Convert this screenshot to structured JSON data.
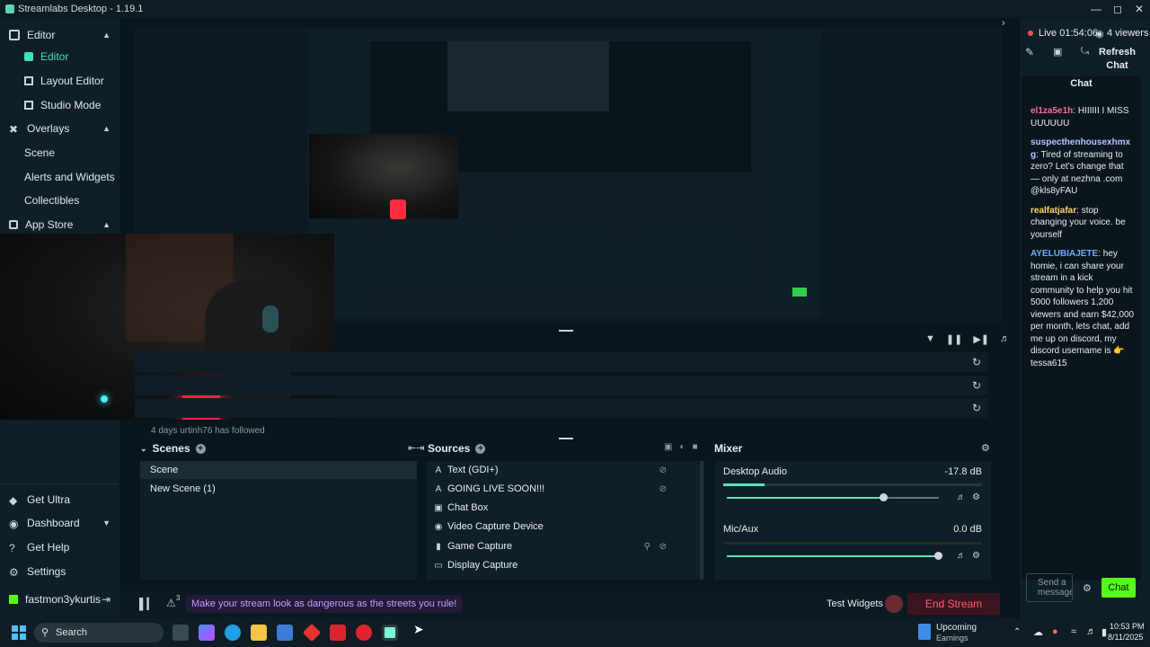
{
  "window": {
    "title": "Streamlabs Desktop - 1.19.1"
  },
  "sidebar": {
    "items": [
      {
        "label": "Editor",
        "type": "section"
      },
      {
        "label": "Editor",
        "type": "sub",
        "active": true
      },
      {
        "label": "Layout Editor",
        "type": "sub"
      },
      {
        "label": "Studio Mode",
        "type": "sub"
      },
      {
        "label": "Overlays",
        "type": "section"
      },
      {
        "label": "Scene",
        "type": "sub"
      },
      {
        "label": "Alerts and Widgets",
        "type": "sub"
      },
      {
        "label": "Collectibles",
        "type": "sub"
      },
      {
        "label": "App Store",
        "type": "section"
      }
    ],
    "bottom": [
      "Get Ultra",
      "Dashboard",
      "Get Help",
      "Settings"
    ],
    "user": "fastmon3ykurtis"
  },
  "scenes": {
    "title": "Scenes",
    "items": [
      "Scene",
      "New Scene (1)"
    ]
  },
  "sources": {
    "title": "Sources",
    "items": [
      {
        "name": "Text (GDI+)",
        "icon": "text-icon"
      },
      {
        "name": "GOING LIVE SOON!!!",
        "icon": "text-icon"
      },
      {
        "name": "Chat Box",
        "icon": "widget-icon"
      },
      {
        "name": "Video Capture Device",
        "icon": "camera-icon"
      },
      {
        "name": "Game Capture",
        "icon": "gamepad-icon"
      },
      {
        "name": "Display Capture",
        "icon": "monitor-icon"
      }
    ]
  },
  "mixer": {
    "title": "Mixer",
    "channels": [
      {
        "name": "Desktop Audio",
        "db": "-17.8 dB",
        "level": 0.74
      },
      {
        "name": "Mic/Aux",
        "db": "0.0 dB",
        "level": 1.0
      }
    ]
  },
  "activity": {
    "partial_text": "4 days   urtinh76   has followed"
  },
  "footer": {
    "promo": "Make your stream look as dangerous as the streets you rule!",
    "alerts_count": "3",
    "test_widgets": "Test Widgets",
    "end_stream": "End Stream"
  },
  "live": {
    "status": "Live 01:54:06",
    "viewers": "4 viewers",
    "refresh": "Refresh Chat"
  },
  "chat": {
    "title": "Chat",
    "messages": [
      {
        "user": "el1za5e1h",
        "color": "#ff6b9a",
        "text": "HIIIIII I MISS UUUUUU"
      },
      {
        "user": "suspecthenhousexhmxg",
        "color": "#b5c7ff",
        "text": "Tired of streaming to zero? Let's change that — only at nezhna .com @kls8yFAU"
      },
      {
        "user": "realfatjafar",
        "color": "#ffd36b",
        "text": "stop changing your voice. be yourself"
      },
      {
        "user": "AYELUBIAJETE",
        "color": "#6fa8ff",
        "text": "hey homie, i can share your stream in a kick community to help you hit 5000 followers 1,200 viewers and earn $42,000 per month, lets chat, add me up on discord, my discord username is 👉 tessa615"
      }
    ],
    "input_placeholder": "Send a message",
    "send": "Chat"
  },
  "taskbar": {
    "search": "Search",
    "news_title": "Upcoming",
    "news_sub": "Earnings",
    "time": "10:53 PM",
    "date": "8/11/2025"
  },
  "colors": {
    "accent": "#3fe2b5",
    "live": "#ff4d4d"
  }
}
